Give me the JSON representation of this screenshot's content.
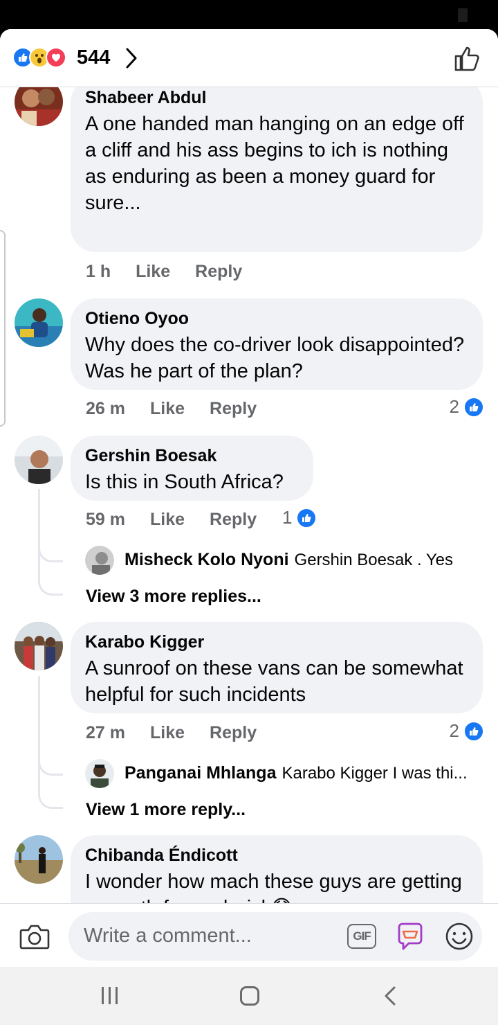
{
  "reactions": {
    "count": "544",
    "types": [
      "like-icon",
      "wow-icon",
      "love-icon"
    ]
  },
  "comments": [
    {
      "author": "Shabeer Abdul",
      "text": "A one handed man hanging on an edge off a cliff and his ass begins to ich is nothing as enduring as been a money guard for sure...",
      "time": "1 h",
      "like_label": "Like",
      "reply_label": "Reply"
    },
    {
      "author": "Otieno Oyoo",
      "text": "Why does the co-driver look disappointed? Was he part of the plan?",
      "time": "26 m",
      "like_label": "Like",
      "reply_label": "Reply",
      "likes": "2"
    },
    {
      "author": "Gershin Boesak",
      "text": "Is this in South Africa?",
      "time": "59 m",
      "like_label": "Like",
      "reply_label": "Reply",
      "likes": "1",
      "reply_preview": {
        "author": "Misheck Kolo Nyoni",
        "text": "Gershin Boesak . Yes"
      },
      "more_replies": "View 3 more replies..."
    },
    {
      "author": "Karabo Kigger",
      "text": "A sunroof on these vans can be somewhat helpful for such incidents",
      "time": "27 m",
      "like_label": "Like",
      "reply_label": "Reply",
      "likes": "2",
      "reply_preview": {
        "author": "Panganai Mhlanga",
        "text": "Karabo Kigger I was thi..."
      },
      "more_replies": "View 1 more reply..."
    },
    {
      "author": "Chibanda Éndicott",
      "text": "I wonder how mach these guys are getting a month for sach risk",
      "emoji": "😟"
    }
  ],
  "composer": {
    "placeholder": "Write a comment...",
    "gif_label": "GIF"
  },
  "colors": {
    "accent": "#1877f2",
    "bubble": "#f0f2f5",
    "muted": "#65676b",
    "love": "#f33e58",
    "wow": "#f7c93a"
  }
}
